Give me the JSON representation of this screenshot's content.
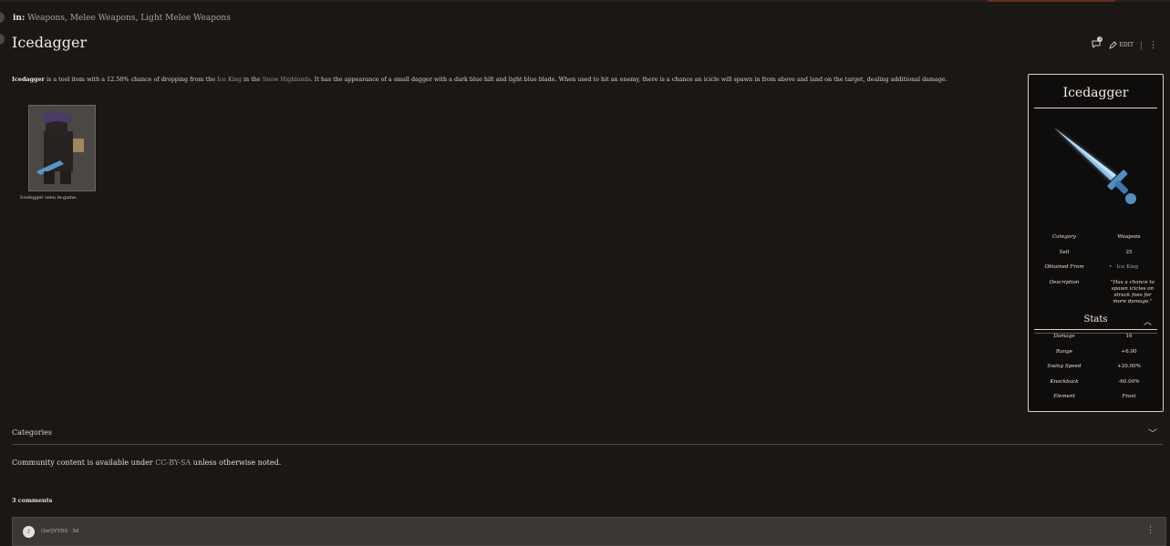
{
  "breadcrumb": {
    "prefix": "in:",
    "items": [
      "Weapons",
      "Melee Weapons",
      "Light Melee Weapons"
    ]
  },
  "page": {
    "title": "Icedagger"
  },
  "toolbar": {
    "comment_count": "3",
    "edit_label": "EDIT"
  },
  "intro": {
    "bold_name": "Icedagger",
    "part1": " is a tool item with a 12.58% chance of dropping from the ",
    "link1": "Ice King",
    "part2": " in the ",
    "link2": "Snow Highlands",
    "part3": ". It has the appearance of a small dagger with a dark blue hilt and light blue blade. When used to hit an enemy, there is a chance an icicle will spawn in from above and land on the target, dealing additional damage."
  },
  "thumbnail": {
    "caption": "Icedagger seen in-game."
  },
  "infobox": {
    "title": "Icedagger",
    "rows": [
      {
        "key": "Category",
        "value": "Weapons"
      },
      {
        "key": "Sell",
        "value": "25"
      },
      {
        "key": "Obtained From",
        "value": "Ice King"
      },
      {
        "key": "Description",
        "value": "\"Has a chance to spawn icicles on struck foes for more damage.\""
      }
    ],
    "stats_title": "Stats",
    "stats": [
      {
        "key": "Damage",
        "value": "16"
      },
      {
        "key": "Range",
        "value": "+6.00"
      },
      {
        "key": "Swing Speed",
        "value": "+20.00%"
      },
      {
        "key": "Knockback",
        "value": "-60.00%"
      },
      {
        "key": "Element",
        "value": "Frost"
      }
    ]
  },
  "categories": {
    "label": "Categories"
  },
  "license": {
    "prefix": "Community content is available under ",
    "link": "CC-BY-SA",
    "suffix": " unless otherwise noted."
  },
  "comments": {
    "heading": "3 comments",
    "first": {
      "user": "QwQYYDS",
      "time": "5d",
      "avatar_glyph": "♪"
    }
  }
}
